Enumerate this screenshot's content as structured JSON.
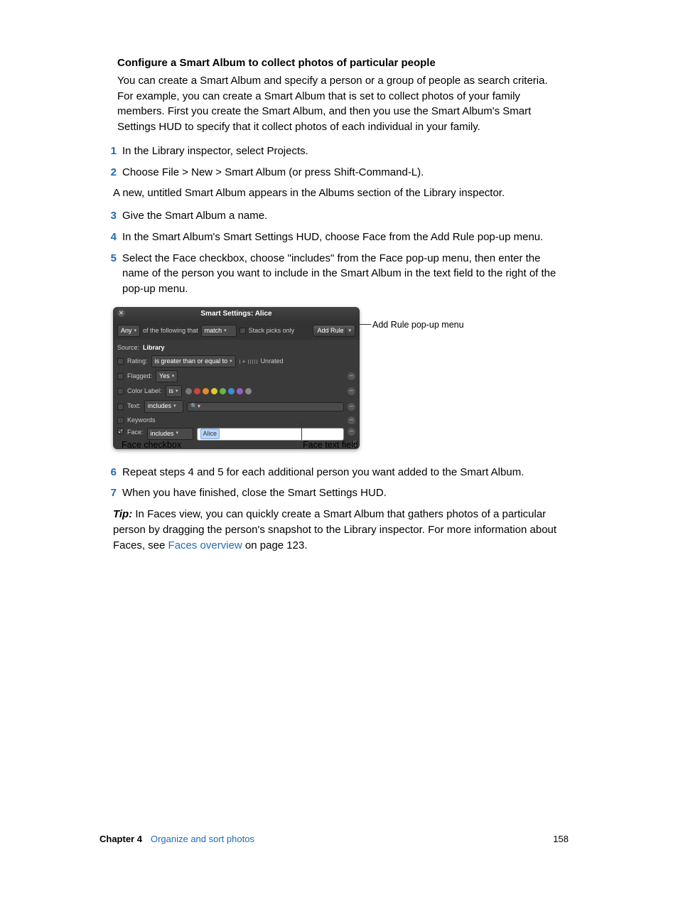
{
  "section_title": "Configure a Smart Album to collect photos of particular people",
  "intro": "You can create a Smart Album and specify a person or a group of people as search criteria. For example, you can create a Smart Album that is set to collect photos of your family members. First you create the Smart Album, and then you use the Smart Album's Smart Settings HUD to specify that it collect photos of each individual in your family.",
  "steps": {
    "n1": "1",
    "t1": "In the Library inspector, select Projects.",
    "n2": "2",
    "t2": "Choose File > New > Smart Album (or press Shift-Command-L).",
    "sub2": "A new, untitled Smart Album appears in the Albums section of the Library inspector.",
    "n3": "3",
    "t3": "Give the Smart Album a name.",
    "n4": "4",
    "t4": "In the Smart Album's Smart Settings HUD, choose Face from the Add Rule pop-up menu.",
    "n5": "5",
    "t5": "Select the Face checkbox, choose \"includes\" from the Face pop-up menu, then enter the name of the person you want to include in the Smart Album in the text field to the right of the pop-up menu.",
    "n6": "6",
    "t6": "Repeat steps 4 and 5 for each additional person you want added to the Smart Album.",
    "n7": "7",
    "t7": "When you have finished, close the Smart Settings HUD."
  },
  "tip": {
    "label": "Tip:",
    "before": "  In Faces view, you can quickly create a Smart Album that gathers photos of a particular person by dragging the person's snapshot to the Library inspector. For more information about Faces, see ",
    "link": "Faces overview",
    "after": " on page 123."
  },
  "hud": {
    "title": "Smart Settings: Alice",
    "any": "Any",
    "following": "of the following that",
    "match": "match",
    "stack": "Stack picks only",
    "add_rule": "Add Rule",
    "source_lbl": "Source:",
    "source_val": "Library",
    "rating_lbl": "Rating:",
    "rating_val": "is greater than or equal to",
    "unrated": "Unrated",
    "flagged_lbl": "Flagged:",
    "flagged_val": "Yes",
    "color_lbl": "Color Label:",
    "color_val": "is",
    "text_lbl": "Text:",
    "text_val": "includes",
    "keywords_lbl": "Keywords",
    "face_lbl": "Face:",
    "face_val": "includes",
    "face_tag": "Alice",
    "colors": [
      "#777",
      "#d24040",
      "#e38a2f",
      "#e3c72f",
      "#6bb742",
      "#3e8fd6",
      "#9560c9",
      "#888"
    ]
  },
  "callouts": {
    "add_rule": "Add Rule pop-up menu",
    "face_checkbox": "Face checkbox",
    "face_text": "Face text field"
  },
  "footer": {
    "chapter": "Chapter 4",
    "title": "Organize and sort photos",
    "page": "158"
  }
}
